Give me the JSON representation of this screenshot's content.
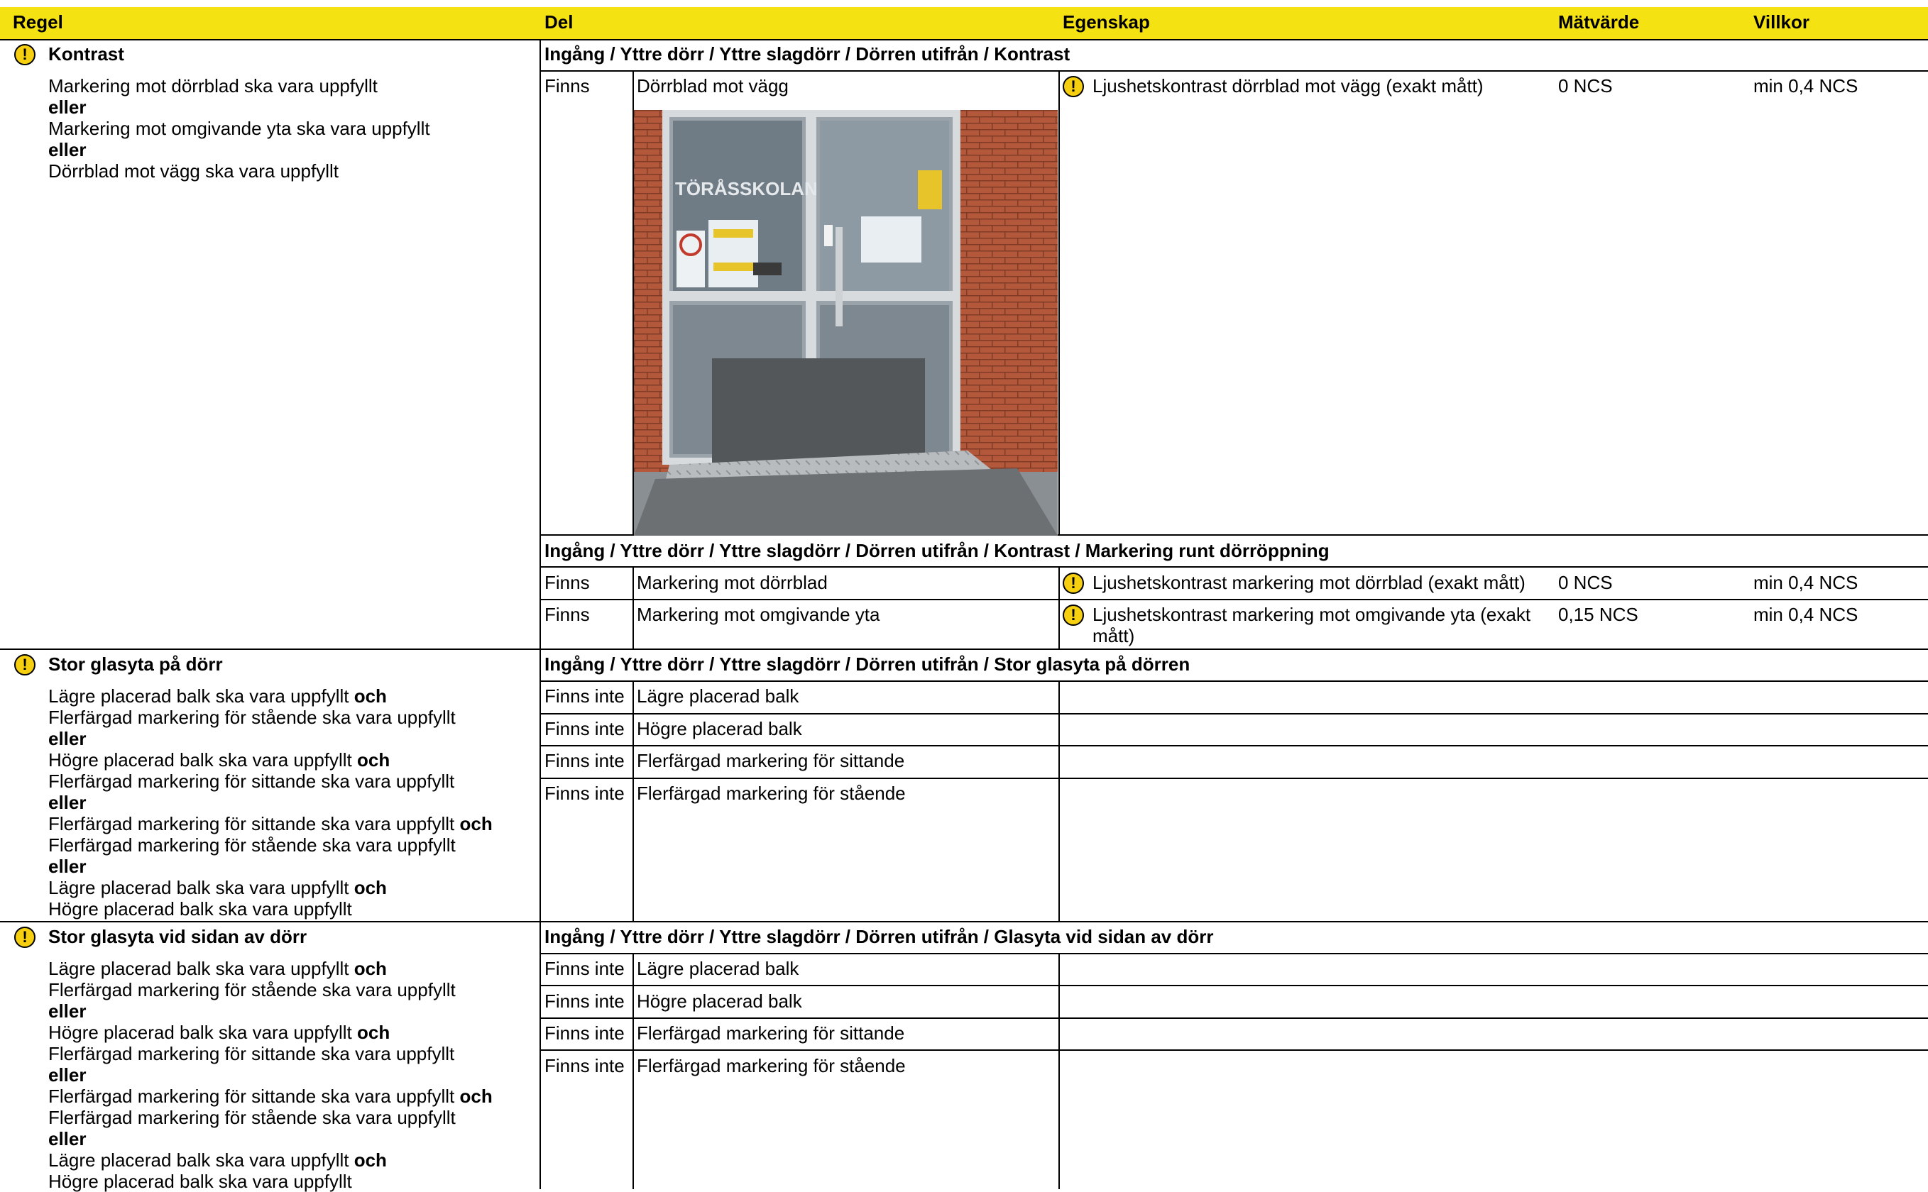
{
  "header": {
    "col_regel": "Regel",
    "col_del": "Del",
    "col_egenskap": "Egenskap",
    "col_matvarde": "Mätvärde",
    "col_villkor": "Villkor"
  },
  "rules": [
    {
      "title": "Kontrast",
      "lines": [
        {
          "text": "Markering mot dörrblad ska vara uppfyllt",
          "bold": ""
        },
        {
          "text": "",
          "bold": "eller"
        },
        {
          "text": "Markering mot omgivande yta ska vara uppfyllt",
          "bold": ""
        },
        {
          "text": "",
          "bold": "eller"
        },
        {
          "text": "Dörrblad mot vägg ska vara uppfyllt",
          "bold": ""
        }
      ]
    },
    {
      "title": "Stor glasyta på dörr",
      "lines": [
        {
          "text": "Lägre placerad balk ska vara uppfyllt ",
          "bold": "och"
        },
        {
          "text": "Flerfärgad markering för stående ska vara uppfyllt",
          "bold": ""
        },
        {
          "text": "",
          "bold": "eller"
        },
        {
          "text": "Högre placerad balk ska vara uppfyllt ",
          "bold": "och"
        },
        {
          "text": "Flerfärgad markering för sittande ska vara uppfyllt",
          "bold": ""
        },
        {
          "text": "",
          "bold": "eller"
        },
        {
          "text": "Flerfärgad markering för sittande ska vara uppfyllt ",
          "bold": "och"
        },
        {
          "text": "Flerfärgad markering för stående ska vara uppfyllt",
          "bold": ""
        },
        {
          "text": "",
          "bold": "eller"
        },
        {
          "text": "Lägre placerad balk ska vara uppfyllt ",
          "bold": "och"
        },
        {
          "text": "Högre placerad balk ska vara uppfyllt",
          "bold": ""
        }
      ]
    },
    {
      "title": "Stor glasyta vid sidan av dörr",
      "lines": [
        {
          "text": "Lägre placerad balk ska vara uppfyllt ",
          "bold": "och"
        },
        {
          "text": "Flerfärgad markering för stående ska vara uppfyllt",
          "bold": ""
        },
        {
          "text": "",
          "bold": "eller"
        },
        {
          "text": "Högre placerad balk ska vara uppfyllt ",
          "bold": "och"
        },
        {
          "text": "Flerfärgad markering för sittande ska vara uppfyllt",
          "bold": ""
        },
        {
          "text": "",
          "bold": "eller"
        },
        {
          "text": "Flerfärgad markering för sittande ska vara uppfyllt ",
          "bold": "och"
        },
        {
          "text": "Flerfärgad markering för stående ska vara uppfyllt",
          "bold": ""
        },
        {
          "text": "",
          "bold": "eller"
        },
        {
          "text": "Lägre placerad balk ska vara uppfyllt ",
          "bold": "och"
        },
        {
          "text": "Högre placerad balk ska vara uppfyllt",
          "bold": ""
        }
      ]
    }
  ],
  "sections": [
    {
      "path": "Ingång / Yttre dörr / Yttre slagdörr  / Dörren utifrån / Kontrast",
      "rows": [
        {
          "status": "Finns",
          "del": "Dörrblad mot vägg",
          "egenskap": "Ljushetskontrast dörrblad mot vägg (exakt mått)",
          "matvarde": "0 NCS",
          "villkor": "min 0,4 NCS"
        }
      ]
    },
    {
      "path": "Ingång / Yttre dörr / Yttre slagdörr  / Dörren utifrån / Kontrast / Markering runt dörröppning",
      "rows": [
        {
          "status": "Finns",
          "del": "Markering mot dörrblad",
          "egenskap": "Ljushetskontrast markering mot dörrblad (exakt mått)",
          "matvarde": "0 NCS",
          "villkor": "min 0,4 NCS"
        },
        {
          "status": "Finns",
          "del": "Markering mot omgivande yta",
          "egenskap": "Ljushetskontrast markering mot omgivande yta (exakt",
          "egenskap2": "mått)",
          "matvarde": "0,15 NCS",
          "villkor": "min 0,4 NCS"
        }
      ]
    },
    {
      "path": "Ingång / Yttre dörr / Yttre slagdörr  / Dörren utifrån / Stor glasyta på dörren",
      "rows": [
        {
          "status": "Finns inte",
          "del": "Lägre placerad balk"
        },
        {
          "status": "Finns inte",
          "del": "Högre placerad balk"
        },
        {
          "status": "Finns inte",
          "del": "Flerfärgad markering för sittande"
        },
        {
          "status": "Finns inte",
          "del": "Flerfärgad markering för stående"
        }
      ]
    },
    {
      "path": "Ingång / Yttre dörr / Yttre slagdörr  / Dörren utifrån / Glasyta vid sidan av dörr",
      "rows": [
        {
          "status": "Finns inte",
          "del": "Lägre placerad balk"
        },
        {
          "status": "Finns inte",
          "del": "Högre placerad balk"
        },
        {
          "status": "Finns inte",
          "del": "Flerfärgad markering för sittande"
        },
        {
          "status": "Finns inte",
          "del": "Flerfärgad markering för stående"
        }
      ]
    }
  ],
  "photo": {
    "sign_text": "TÖRÅSSKOLAN"
  },
  "colors": {
    "header_bg": "#f5e213",
    "warn_fill": "#f5cf10"
  },
  "icons": {
    "warning": "!"
  }
}
